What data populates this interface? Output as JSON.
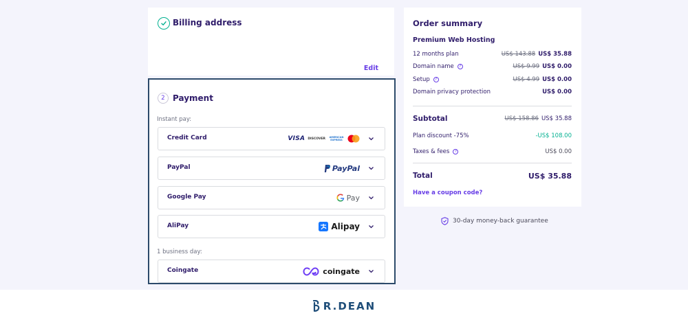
{
  "billing": {
    "title": "Billing address",
    "edit_label": "Edit"
  },
  "payment": {
    "step": "2",
    "title": "Payment",
    "instant_label": "Instant pay:",
    "business_label": "1 business day:",
    "options": [
      {
        "name": "Credit Card",
        "logo": "visa-discover-amex-mastercard"
      },
      {
        "name": "PayPal",
        "logo_text": "PayPal"
      },
      {
        "name": "Google Pay",
        "logo_text": "Pay"
      },
      {
        "name": "AliPay",
        "logo_text": "Alipay"
      },
      {
        "name": "Coingate",
        "logo_text": "coingate"
      }
    ],
    "card_logos": {
      "visa": "VISA",
      "discover": "DISCOVER",
      "amex": "AMERICAN EXPRESS"
    }
  },
  "summary": {
    "title": "Order summary",
    "plan": "Premium Web Hosting",
    "lines": [
      {
        "label": "12 months plan",
        "old": "US$ 143.88",
        "new": "US$ 35.88"
      },
      {
        "label": "Domain name",
        "old": "US$ 9.99",
        "new": "US$ 0.00"
      },
      {
        "label": "Setup",
        "old": "US$ 4.99",
        "new": "US$ 0.00"
      },
      {
        "label": "Domain privacy protection",
        "new": "US$ 0.00"
      }
    ],
    "subtotal": {
      "label": "Subtotal",
      "old": "US$ 158.86",
      "new": "US$ 35.88"
    },
    "discount": {
      "label": "Plan discount -75%",
      "value": "-US$ 108.00"
    },
    "taxes": {
      "label": "Taxes & fees",
      "value": "US$ 0.00"
    },
    "total": {
      "label": "Total",
      "value": "US$ 35.88"
    },
    "coupon_label": "Have a coupon code?"
  },
  "guarantee": "30-day money-back guarantee",
  "footer": {
    "brand": "R.DEAN"
  },
  "colors": {
    "accent": "#673de6",
    "success": "#00b090",
    "navy": "#2f1c6a",
    "border_focus": "#2c4a6a"
  }
}
